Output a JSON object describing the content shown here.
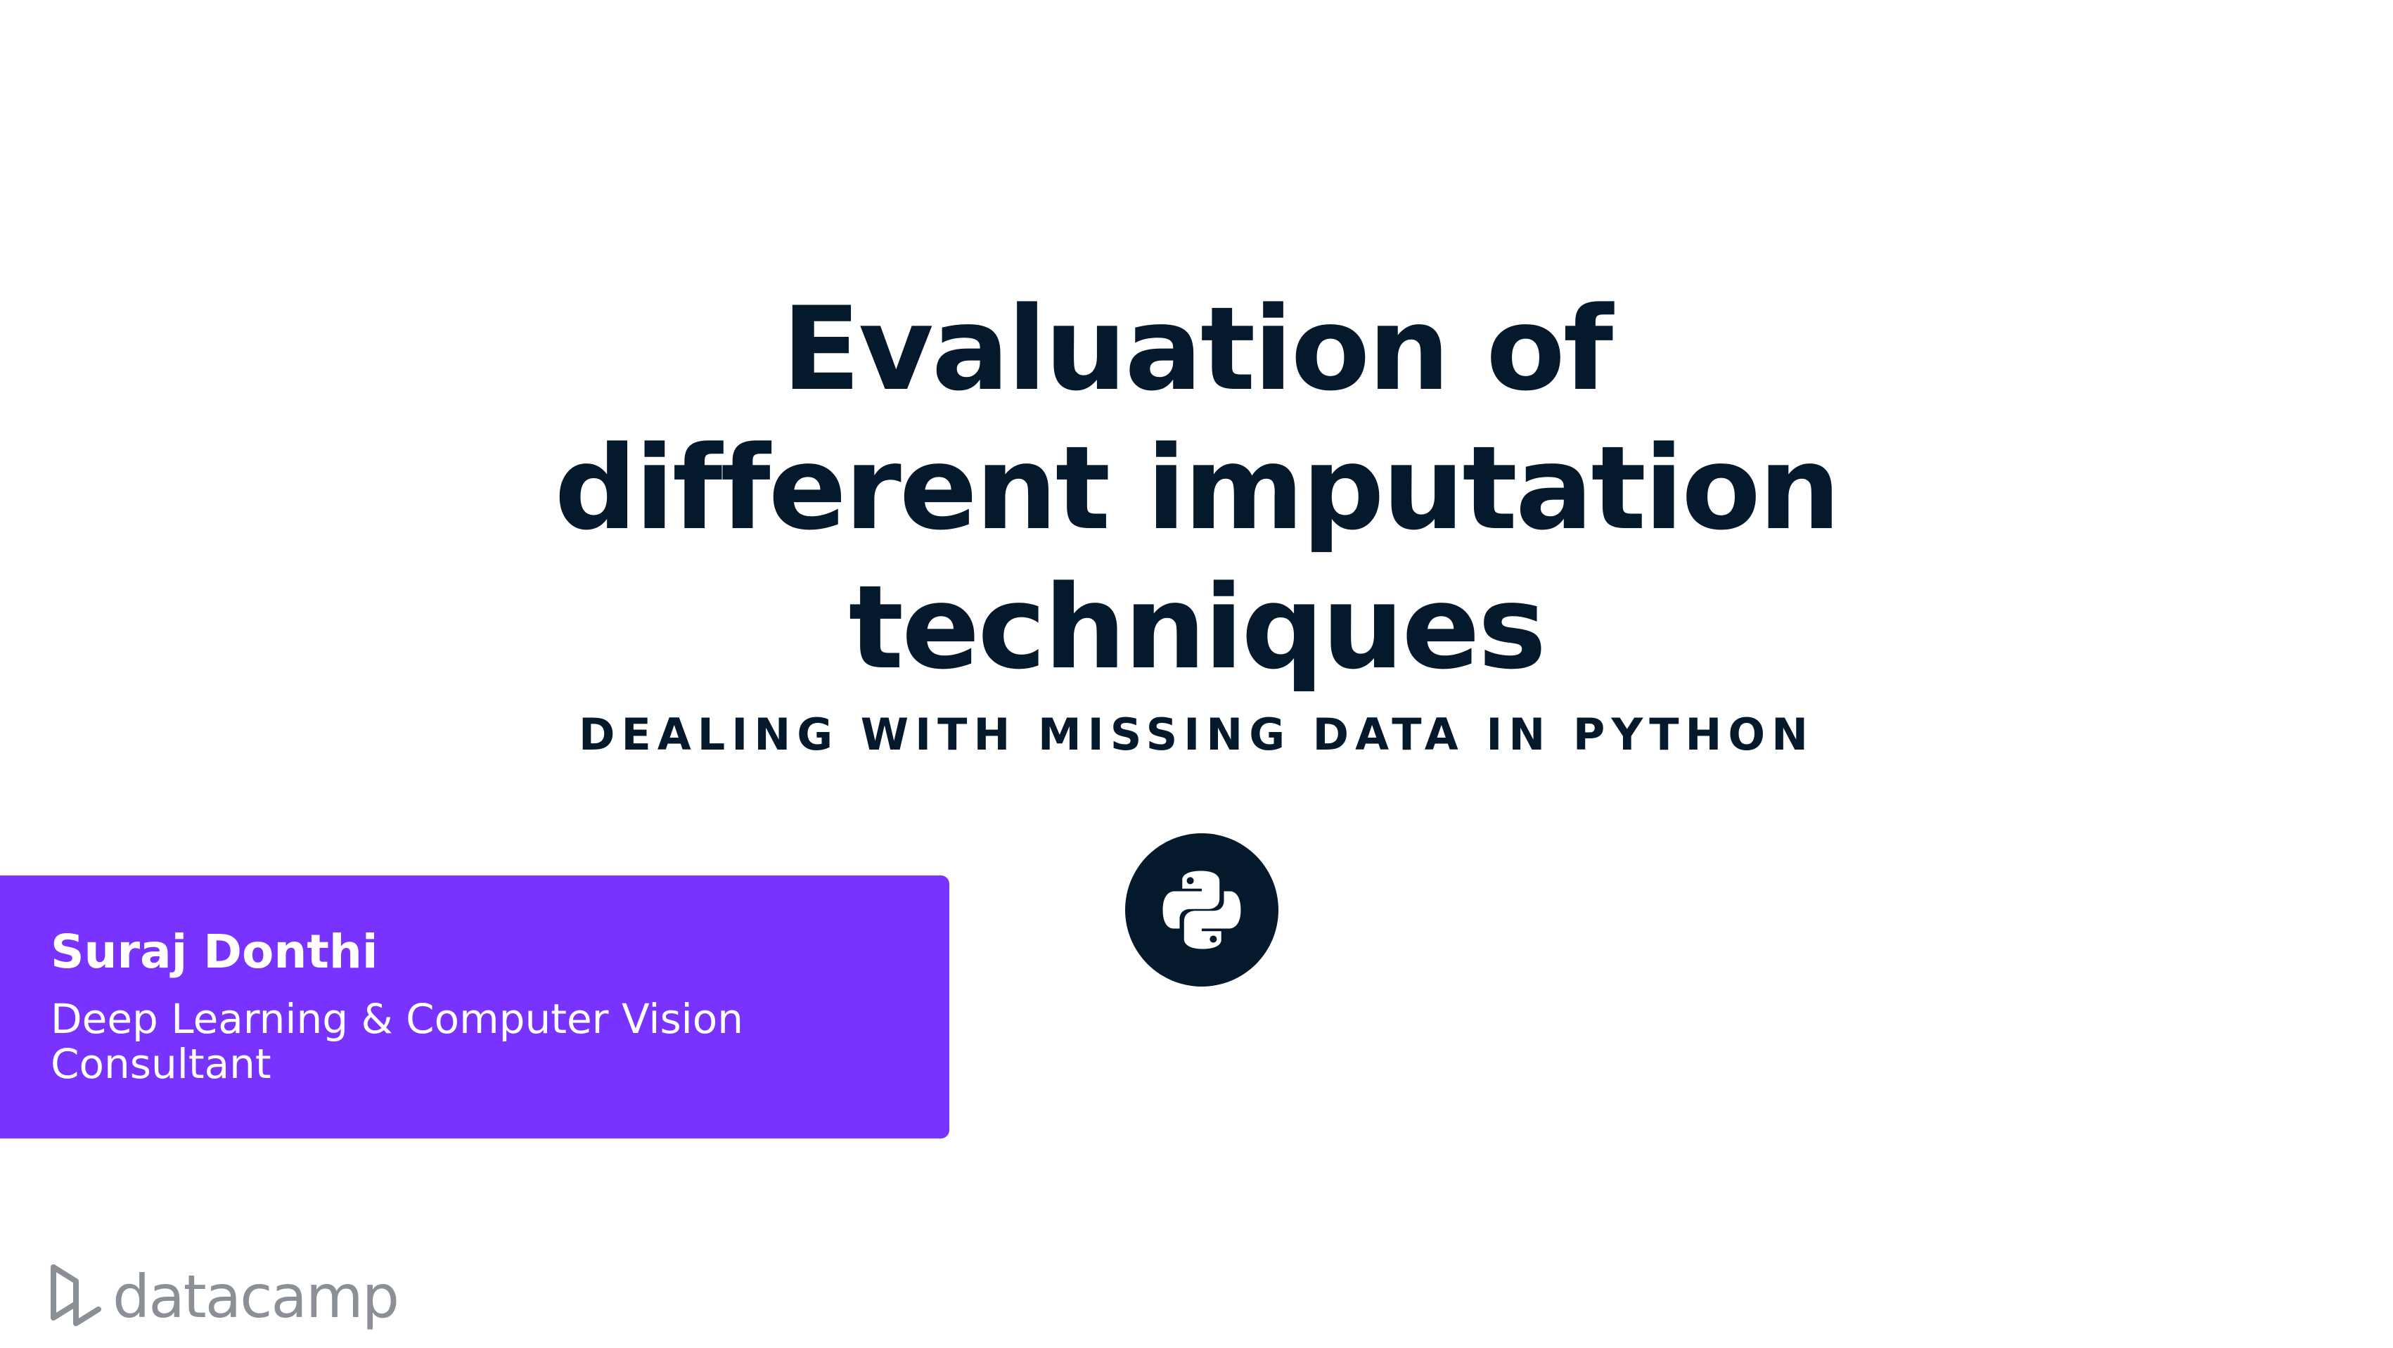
{
  "slide": {
    "title_lines": [
      "Evaluation of",
      "different imputation",
      "techniques"
    ],
    "course_name": "DEALING WITH MISSING DATA IN PYTHON",
    "badge_icon": "python-logo-icon"
  },
  "author": {
    "name": "Suraj Donthi",
    "role": "Deep Learning & Computer Vision Consultant"
  },
  "brand": {
    "logo_icon": "datacamp-logo-icon",
    "wordmark": "datacamp"
  },
  "colors": {
    "background": "#ffffff",
    "text_dark": "#05192d",
    "accent_purple": "#7933ff",
    "brand_gray": "#8b8f96"
  }
}
